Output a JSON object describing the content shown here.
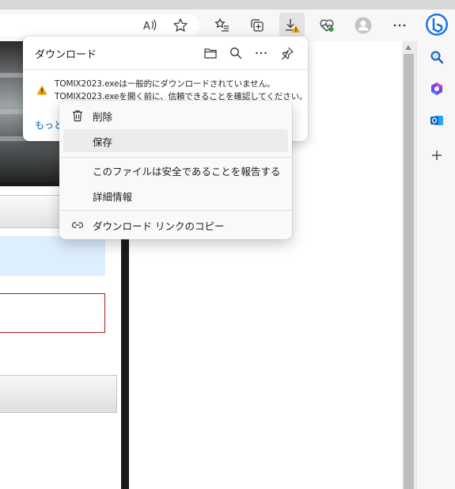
{
  "toolbar": {
    "icons": [
      "read-aloud-icon",
      "favorite-star-icon",
      "favorites-list-icon",
      "collections-icon",
      "downloads-warning-icon",
      "browser-essentials-icon",
      "profile-avatar-icon",
      "more-menu-icon"
    ]
  },
  "sidebar": {
    "icons": [
      "bing-copilot-icon",
      "search-icon",
      "office-icon",
      "outlook-icon",
      "add-icon"
    ]
  },
  "download_panel": {
    "title": "ダウンロード",
    "header_icons": [
      "open-folder-icon",
      "search-icon",
      "more-options-icon",
      "pin-icon"
    ],
    "message_line1": "TOMIX2023.exeは一般的にダウンロードされていません。",
    "message_line2": "TOMIX2023.exeを開く前に、信頼できることを確認してください。",
    "link_text": "もっと"
  },
  "context_menu": {
    "items": [
      {
        "label": "削除",
        "icon": "trash-icon"
      },
      {
        "label": "保存",
        "icon": ""
      },
      {
        "label": "このファイルは安全であることを報告する",
        "icon": ""
      },
      {
        "label": "詳細情報",
        "icon": ""
      },
      {
        "label": "ダウンロード リンクのコピー",
        "icon": "link-icon"
      }
    ]
  },
  "colors": {
    "warning": "#e8a200",
    "link": "#0066b4",
    "outlook": "#0a64c8",
    "bing": "#1a73e8"
  }
}
